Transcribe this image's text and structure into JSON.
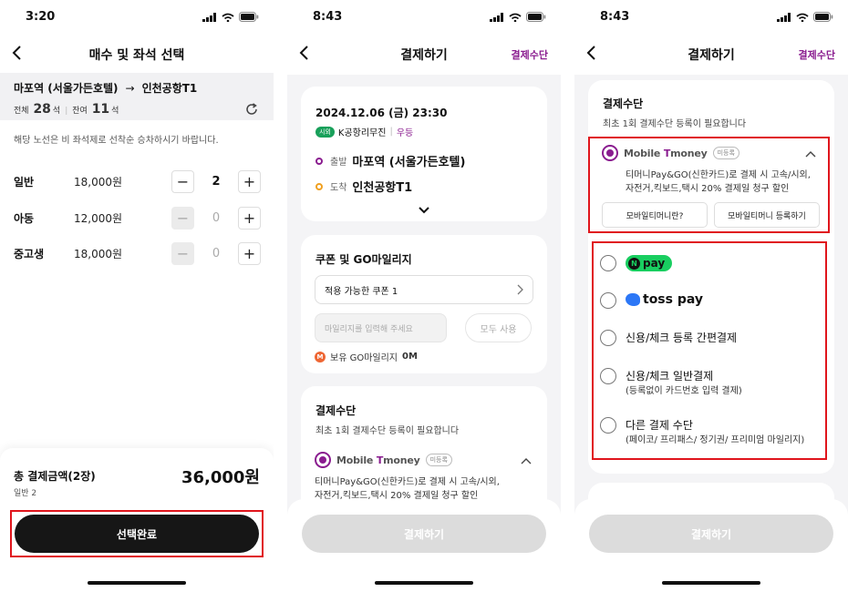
{
  "colors": {
    "brand": "#8a1c8f",
    "highlight": "#e0151c",
    "primary_button": "#161616",
    "disabled_button": "#dcdcdc",
    "npay_green": "#19ce60",
    "toss_blue": "#2c77f6"
  },
  "screen1": {
    "time": "3:20",
    "title": "매수 및 좌석 선택",
    "route": {
      "from": "마포역 (서울가든호텔)",
      "arrow": "→",
      "to": "인천공항T1"
    },
    "seats": {
      "total_label": "전체",
      "total": "28",
      "remain_label": "잔여",
      "remain": "11",
      "unit": "석"
    },
    "notice": "해당 노선은 비 좌석제로 선착순 승차하시기 바랍니다.",
    "fares": [
      {
        "name": "일반",
        "price": "18,000원",
        "qty": "2",
        "minus_enabled": true
      },
      {
        "name": "아동",
        "price": "12,000원",
        "qty": "0",
        "minus_enabled": false
      },
      {
        "name": "중고생",
        "price": "18,000원",
        "qty": "0",
        "minus_enabled": false
      }
    ],
    "total": {
      "label": "총 결제금액(2장)",
      "amount": "36,000원",
      "sub": "일반 2"
    },
    "button": "선택완료"
  },
  "screen2": {
    "time": "8:43",
    "title": "결제하기",
    "header_right": "결제수단",
    "trip": {
      "datetime": "2024.12.06 (금) 23:30",
      "tag": "시외",
      "operator": "K공항리무진",
      "via": "우등",
      "depart_label": "출발",
      "depart": "마포역 (서울가든호텔)",
      "arrive_label": "도착",
      "arrive": "인천공항T1"
    },
    "coupon": {
      "title": "쿠폰 및 GO마일리지",
      "select": "적용 가능한 쿠폰 1",
      "placeholder": "마일리지를 입력해 주세요",
      "use_all": "모두 사용",
      "coin": "M",
      "balance_label": "보유 GO마일리지",
      "balance": "0M"
    },
    "payment": {
      "title": "결제수단",
      "sub": "최초 1회 결제수단 등록이 필요합니다",
      "tmoney_brand_prefix": "Mobile ",
      "tmoney_brand_t": "T",
      "tmoney_brand_suffix": "money",
      "unregistered": "미등록",
      "desc_line1": "티머니Pay&GO(신한카드)로 결제 시 고속/시외,",
      "desc_line2": "자전거,킥보드,택시 20% 결제일 청구 할인"
    },
    "button": "결제하기"
  },
  "screen3": {
    "time": "8:43",
    "title": "결제하기",
    "header_right": "결제수단",
    "payment": {
      "title": "결제수단",
      "sub": "최초 1회 결제수단 등록이 필요합니다",
      "tmoney_brand_prefix": "Mobile ",
      "tmoney_brand_t": "T",
      "tmoney_brand_suffix": "money",
      "unregistered": "미등록",
      "desc_line1": "티머니Pay&GO(신한카드)로 결제 시 고속/시외,",
      "desc_line2": "자전거,킥보드,택시 20% 결제일 청구 할인",
      "btn_what": "모바일티머니란?",
      "btn_register": "모바일티머니 등록하기"
    },
    "options": {
      "npay_n": "N",
      "npay_text": "pay",
      "toss": "toss pay",
      "card_simple": "신용/체크 등록 간편결제",
      "card_general": "신용/체크 일반결제",
      "card_general_sub": "(등록없이 카드번호 입력 결제)",
      "other": "다른 결제 수단",
      "other_sub": "(페이코/ 프리패스/ 정기권/ 프리미엄 마일리지)"
    },
    "button": "결제하기"
  }
}
